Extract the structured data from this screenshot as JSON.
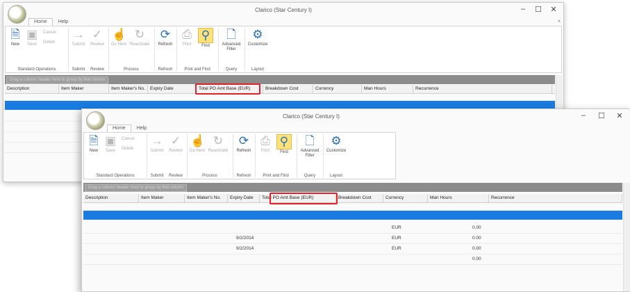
{
  "window": {
    "title": "Clarico (Star Century I)",
    "tabs": [
      "Home",
      "Help"
    ],
    "controls": {
      "minimize": "–",
      "maximize": "☐",
      "close": "✕"
    },
    "collapse_icon": "chevron-up-icon"
  },
  "ribbon": {
    "new": "New",
    "save": "Save",
    "cancel": "Cancel",
    "delete": "Delete",
    "submit": "Submit",
    "review": "Review",
    "go_next": "Go Next",
    "reactivate": "Reactivate",
    "refresh": "Refresh",
    "print": "Print",
    "find": "Find",
    "advanced_filter": "Advanced Filter",
    "customize": "Customize",
    "groups": {
      "standard_operations": "Standard Operations",
      "submit": "Submit",
      "review": "Review",
      "process": "Process",
      "refresh": "Refresh",
      "print_and_find": "Print and Find",
      "query": "Query",
      "layout": "Layout"
    }
  },
  "grid": {
    "group_hint": "Drag a column header here to group by that column",
    "columns": [
      "Description",
      "Item Maker",
      "Item Maker's No.",
      "Expiry Date",
      "Total PO Amt Base (EUR)",
      "Breakdown Cost",
      "Currency",
      "Man Hours",
      "Recurrence"
    ],
    "highlighted_column": "Total PO Amt Base (EUR)",
    "rows": [
      {
        "expiry": "",
        "currency": "EUR",
        "man_hours": "0.00"
      },
      {
        "expiry": "9/2/2014",
        "currency": "EUR",
        "man_hours": "0.00"
      },
      {
        "expiry": "9/2/2014",
        "currency": "EUR",
        "man_hours": "0.00"
      },
      {
        "expiry": "",
        "currency": "",
        "man_hours": "0.00"
      }
    ]
  },
  "colors": {
    "selection": "#1a7ce0",
    "highlight_box": "#e0202a",
    "find_button": "#ffe27a"
  }
}
